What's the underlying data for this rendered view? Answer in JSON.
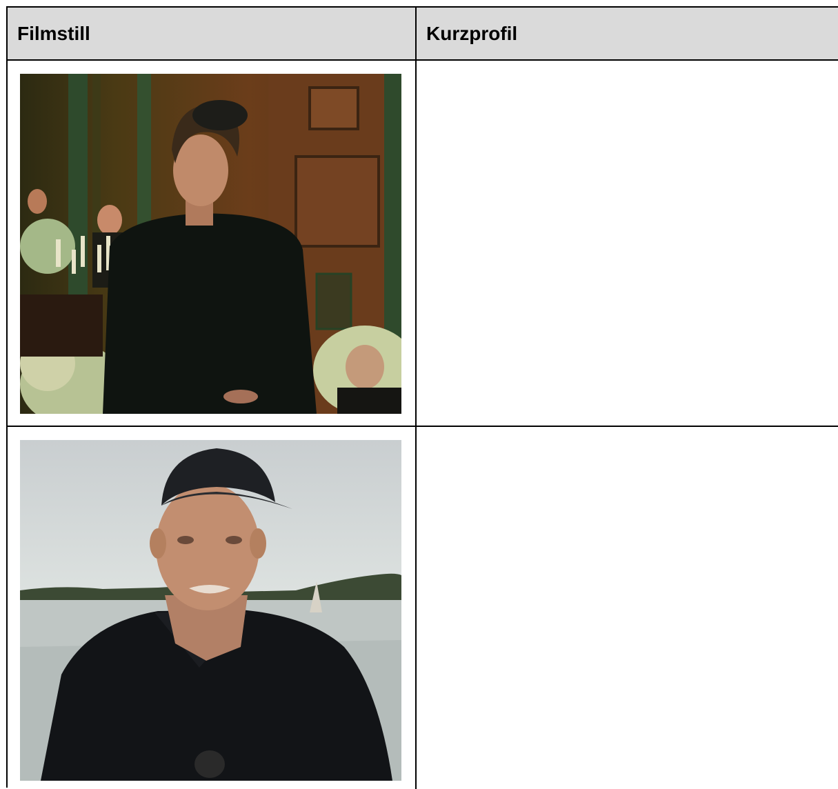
{
  "table": {
    "headers": [
      "Filmstill",
      "Kurzprofil"
    ],
    "rows": [
      {
        "profile": ""
      },
      {
        "profile": ""
      }
    ]
  },
  "colors": {
    "header_bg": "#dadada",
    "border": "#000000"
  }
}
